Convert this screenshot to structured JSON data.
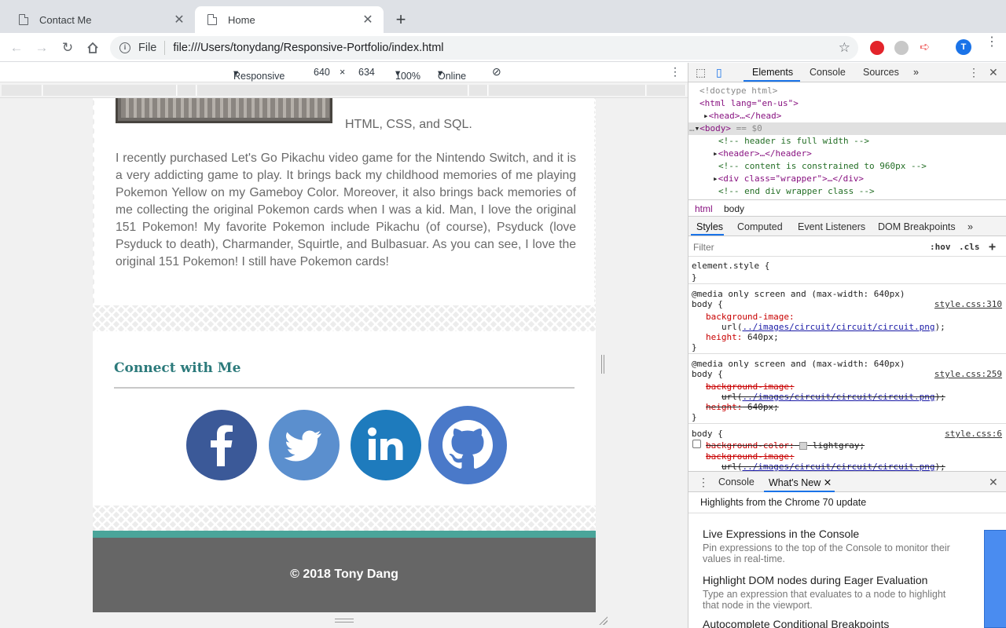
{
  "browser": {
    "tabs": [
      {
        "title": "Contact Me",
        "active": false
      },
      {
        "title": "Home",
        "active": true
      }
    ],
    "address": {
      "scheme": "File",
      "url": "file:///Users/tonydang/Responsive-Portfolio/index.html"
    },
    "avatar_letter": "T"
  },
  "device_toolbar": {
    "mode": "Responsive",
    "width": "640",
    "times": "×",
    "height": "634",
    "zoom": "100%",
    "throttle": "Online"
  },
  "page": {
    "skills_text": "HTML, CSS, and SQL.",
    "paragraph": "I recently purchased Let's Go Pikachu video game for the Nintendo Switch, and it is a very addicting game to play. It brings back my childhood memories of me playing Pokemon Yellow on my Gameboy Color. Moreover, it also brings back memories of me collecting the original Pokemon cards when I was a kid. Man, I love the original 151 Pokemon! My favorite Pokemon include Pikachu (of course), Psyduck (love Psyduck to death), Charmander, Squirtle, and Bulbasuar. As you can see, I love the original 151 Pokemon! I still have Pokemon cards!",
    "connect_heading": "Connect with Me",
    "social": [
      {
        "name": "facebook",
        "icon": "facebook-icon",
        "color": "#3b5998"
      },
      {
        "name": "twitter",
        "icon": "twitter-icon",
        "color": "#5b8fce"
      },
      {
        "name": "linkedin",
        "icon": "linkedin-icon",
        "color": "#1e7bbd"
      },
      {
        "name": "github",
        "icon": "github-icon",
        "color": "#4a79c9"
      }
    ],
    "footer": "© 2018 Tony Dang",
    "accent": "#4aa59a"
  },
  "devtools": {
    "tabs": [
      "Elements",
      "Console",
      "Sources",
      "»"
    ],
    "dom": {
      "doctype": "<!doctype html>",
      "html_open": "<html lang=\"en-us\">",
      "head": "<head>…</head>",
      "body": "<body>",
      "body_suffix": " == $0",
      "c1": "<!-- header is full width -->",
      "header": "<header>…</header>",
      "c2": "<!-- content is constrained to 960px -->",
      "div": "<div class=\"wrapper\">…</div>",
      "c3": "<!-- end div wrapper class -->"
    },
    "breadcrumbs": [
      "html",
      "body"
    ],
    "style_tabs": [
      "Styles",
      "Computed",
      "Event Listeners",
      "DOM Breakpoints",
      "»"
    ],
    "filter_placeholder": "Filter",
    "hov": ":hov",
    "cls": ".cls",
    "rules": {
      "element_style": "element.style {",
      "close": "}",
      "media": "@media only screen and (max-width: 640px)",
      "body_sel": "body {",
      "src1": "style.css:310",
      "src2": "style.css:259",
      "src3": "style.css:6",
      "bg_image": "background-image:",
      "url_pre": "url(",
      "url_link": "../images/circuit/circuit/circuit.png",
      "url_post": ");",
      "height_prop": "height:",
      "height_val": "640px;",
      "bg_color": "background-color:",
      "bg_color_val": "lightgray;"
    },
    "drawer_tabs": [
      "Console",
      "What's New"
    ],
    "whats_new": {
      "header": "Highlights from the Chrome 70 update",
      "items": [
        {
          "title": "Live Expressions in the Console",
          "desc": "Pin expressions to the top of the Console to monitor their values in real-time."
        },
        {
          "title": "Highlight DOM nodes during Eager Evaluation",
          "desc": "Type an expression that evaluates to a node to highlight that node in the viewport."
        },
        {
          "title": "Autocomplete Conditional Breakpoints",
          "desc": ""
        }
      ]
    }
  }
}
